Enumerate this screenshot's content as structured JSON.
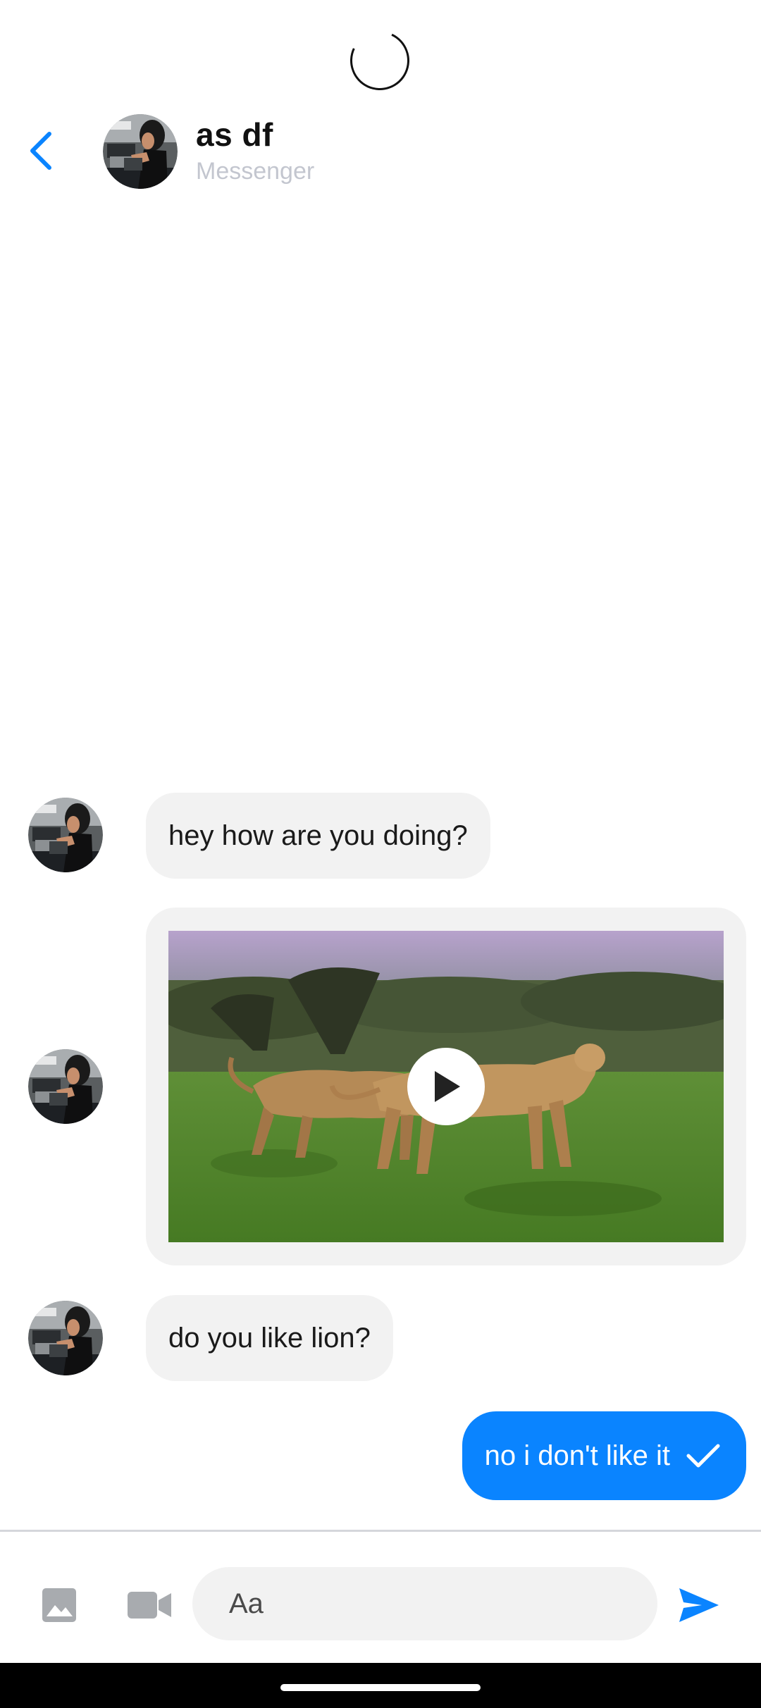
{
  "header": {
    "contact_name": "as df",
    "contact_subtitle": "Messenger"
  },
  "messages": [
    {
      "direction": "incoming",
      "type": "text",
      "text": "hey how are you doing?"
    },
    {
      "direction": "incoming",
      "type": "video",
      "thumbnail": "lions-walking-in-savanna"
    },
    {
      "direction": "incoming",
      "type": "text",
      "text": "do you like lion?"
    },
    {
      "direction": "outgoing",
      "type": "text",
      "text": "no i don't like it",
      "status_icon": "check-icon"
    }
  ],
  "composer": {
    "placeholder": "Aa",
    "value": ""
  },
  "colors": {
    "accent": "#0a84ff",
    "incoming_bubble": "#f2f2f2",
    "subtitle": "#c3c6cf"
  }
}
